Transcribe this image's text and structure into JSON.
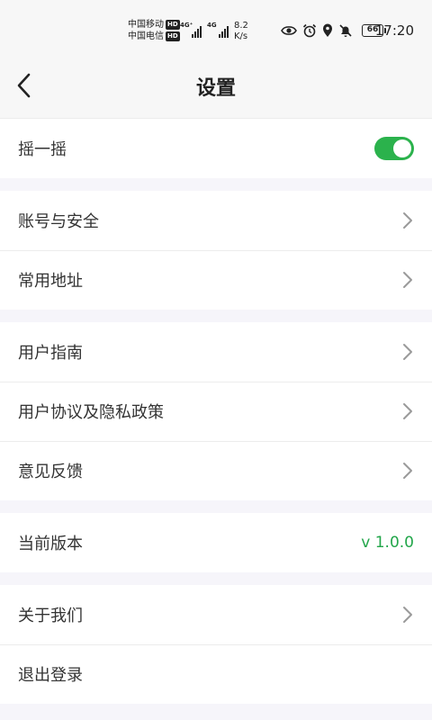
{
  "status_bar": {
    "carrier_1": "中国移动",
    "carrier_2": "中国电信",
    "hd_badge": "HD",
    "net_type_1": "4G⁺",
    "net_type_2": "4G",
    "net_speed_value": "8.2",
    "net_speed_unit": "K/s",
    "battery_level": "66",
    "time": "17:20"
  },
  "header": {
    "title": "设置"
  },
  "settings": {
    "shake_label": "摇一摇",
    "shake_enabled": true,
    "account_security": "账号与安全",
    "common_address": "常用地址",
    "user_guide": "用户指南",
    "user_agreement": "用户协议及隐私政策",
    "feedback": "意见反馈",
    "current_version_label": "当前版本",
    "current_version_value": "v 1.0.0",
    "about_us": "关于我们",
    "logout": "退出登录"
  },
  "colors": {
    "accent_green": "#2bb24c",
    "version_green": "#22a64a",
    "page_background": "#f6f5fa"
  }
}
